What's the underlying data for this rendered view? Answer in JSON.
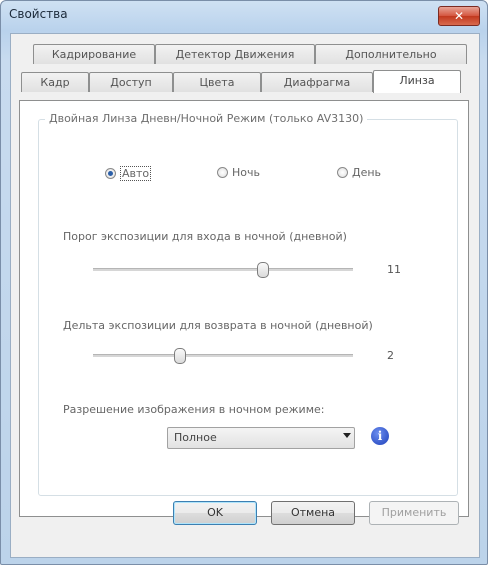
{
  "window": {
    "title": "Свойства",
    "close_label": "✕"
  },
  "tabs": {
    "row1": [
      "Кадрирование",
      "Детектор Движения",
      "Дополнительно"
    ],
    "row2": [
      "Кадр",
      "Доступ",
      "Цвета",
      "Диафрагма",
      "Линза"
    ],
    "active": "Линза"
  },
  "group": {
    "title": "Двойная Линза Дневн/Ночной Режим (только AV3130)"
  },
  "mode": {
    "options": [
      "Авто",
      "Ночь",
      "День"
    ],
    "selected": "Авто"
  },
  "threshold": {
    "label": "Порог экспозиции для входа в ночной (дневной)",
    "value": "11",
    "level_fraction": 0.65
  },
  "delta": {
    "label": "Дельта экспозиции для возврата в ночной (дневной)",
    "value": "2",
    "level_fraction": 0.33
  },
  "resolution": {
    "label": "Разрешение изображения в ночном режиме:",
    "selected": "Полное",
    "info_icon": "info-icon"
  },
  "buttons": {
    "ok": "OK",
    "cancel": "Отмена",
    "apply": "Применить"
  },
  "colors": {
    "accent": "#2b5fa8",
    "close": "#c2381e"
  }
}
